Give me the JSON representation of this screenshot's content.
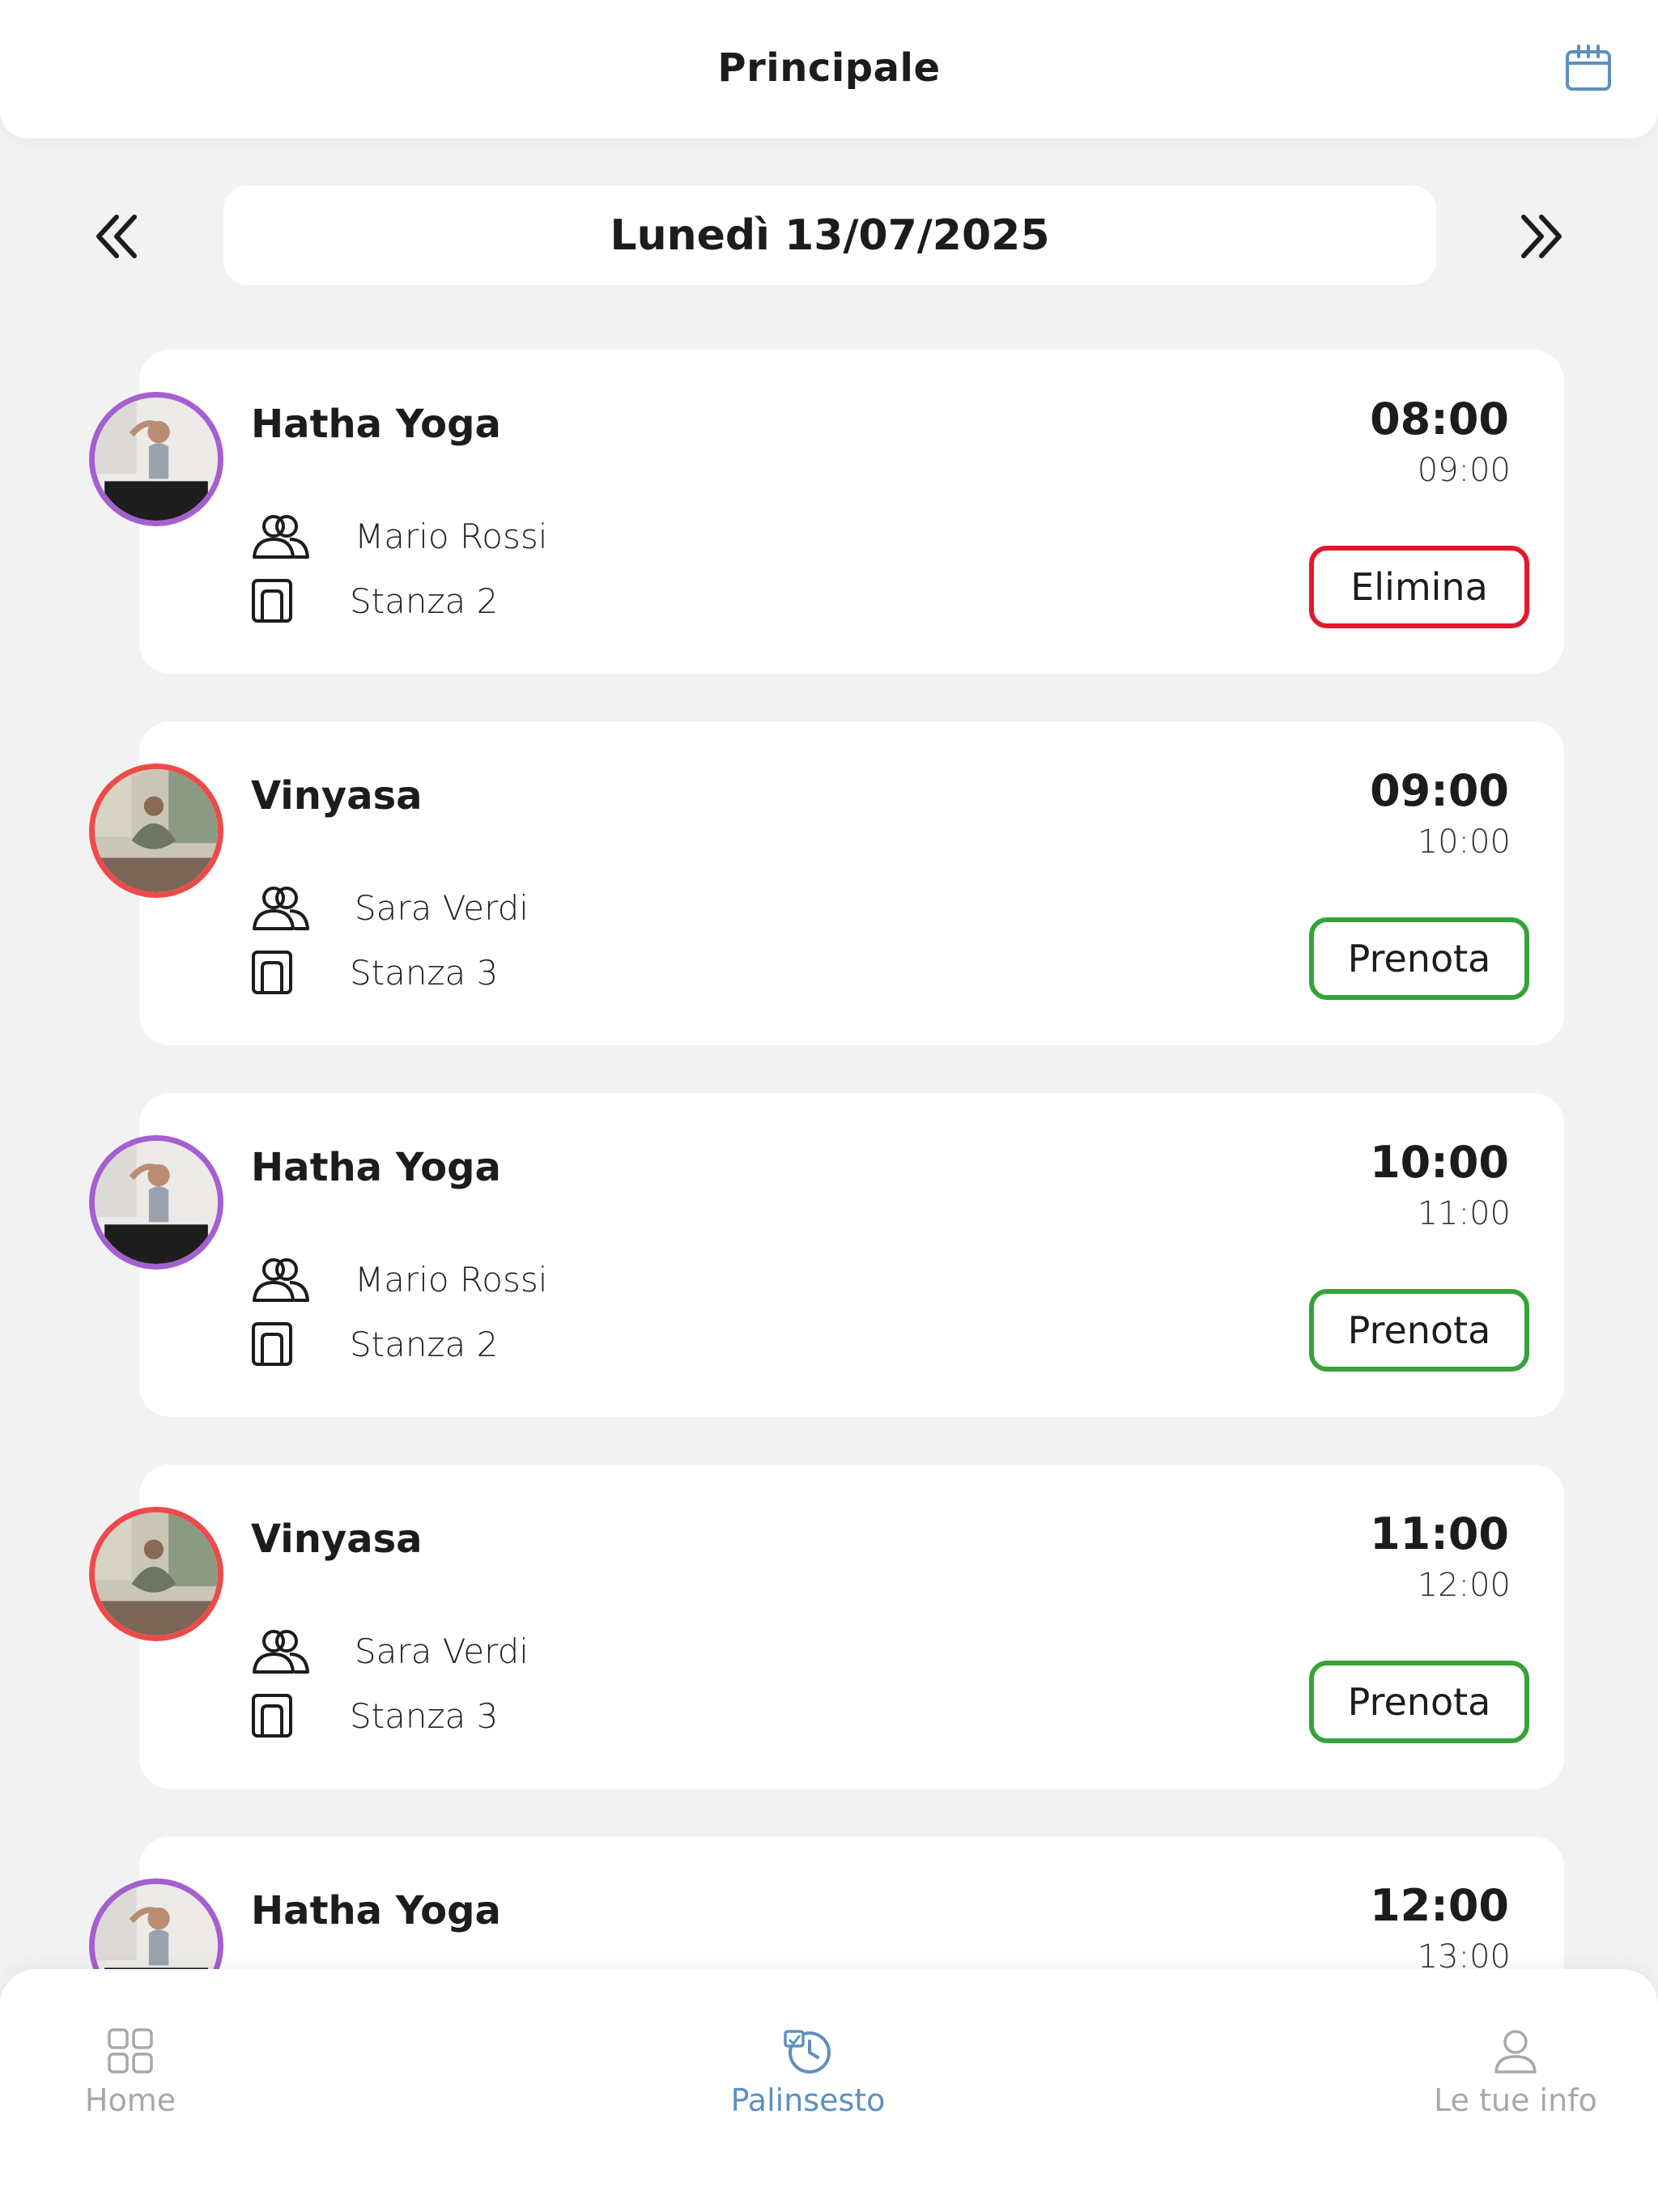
{
  "header": {
    "title": "Principale",
    "calendar_icon": "calendar-icon",
    "accent_color": "#5e8fbf"
  },
  "date_nav": {
    "prev_icon": "double-chevron-left-icon",
    "next_icon": "double-chevron-right-icon",
    "date_label": "Lunedì 13/07/2025"
  },
  "classes": [
    {
      "title": "Hatha Yoga",
      "instructor": "Mario Rossi",
      "room": "Stanza 2",
      "start": "08:00",
      "end": "09:00",
      "action": "Elimina",
      "action_color": "#e3182a",
      "ring_color": "#a55fd0"
    },
    {
      "title": "Vinyasa",
      "instructor": "Sara Verdi",
      "room": "Stanza 3",
      "start": "09:00",
      "end": "10:00",
      "action": "Prenota",
      "action_color": "#36a336",
      "ring_color": "#ee4a4a"
    },
    {
      "title": "Hatha Yoga",
      "instructor": "Mario Rossi",
      "room": "Stanza 2",
      "start": "10:00",
      "end": "11:00",
      "action": "Prenota",
      "action_color": "#36a336",
      "ring_color": "#a55fd0"
    },
    {
      "title": "Vinyasa",
      "instructor": "Sara Verdi",
      "room": "Stanza 3",
      "start": "11:00",
      "end": "12:00",
      "action": "Prenota",
      "action_color": "#36a336",
      "ring_color": "#ee4a4a"
    },
    {
      "title": "Hatha Yoga",
      "start": "12:00",
      "end": "13:00",
      "ring_color": "#a55fd0"
    }
  ],
  "bottom_nav": {
    "tabs": [
      {
        "label": "Home",
        "icon": "grid-icon",
        "active": false
      },
      {
        "label": "Palinsesto",
        "icon": "schedule-history-icon",
        "active": true
      },
      {
        "label": "Le tue info",
        "icon": "user-icon",
        "active": false
      }
    ]
  }
}
